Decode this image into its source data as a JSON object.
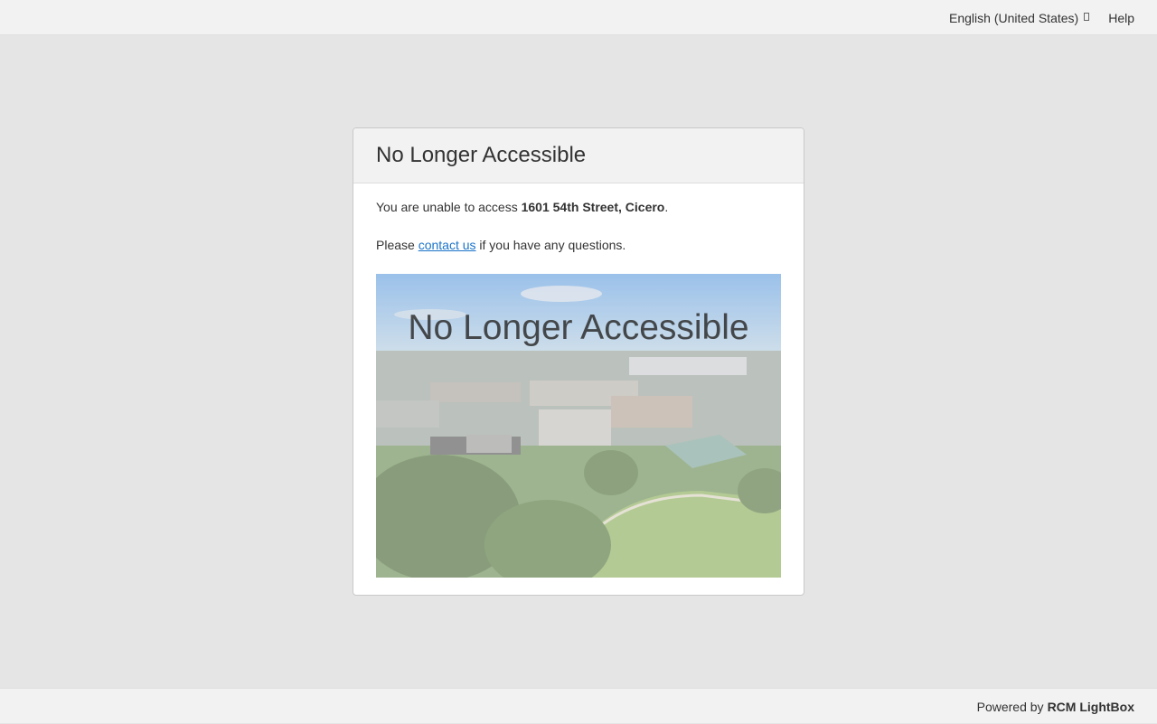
{
  "header": {
    "language_label": "English (United States)",
    "language_icon": "caret-icon",
    "help_label": "Help"
  },
  "card": {
    "title": "No Longer Accessible",
    "line1_prefix": "You are unable to access",
    "address": "1601 54th Street, Cicero",
    "line1_suffix": ".",
    "line2_prefix": "Please",
    "contact_link": "contact us",
    "line2_suffix": "if you have any questions.",
    "photo_caption": "No Longer Accessible"
  },
  "footer": {
    "powered_by": "Powered by",
    "brand": "RCM LightBox"
  },
  "colors": {
    "page_background": "#e5e5e5",
    "bar_background": "#f2f2f2",
    "link": "#1a73c9"
  }
}
